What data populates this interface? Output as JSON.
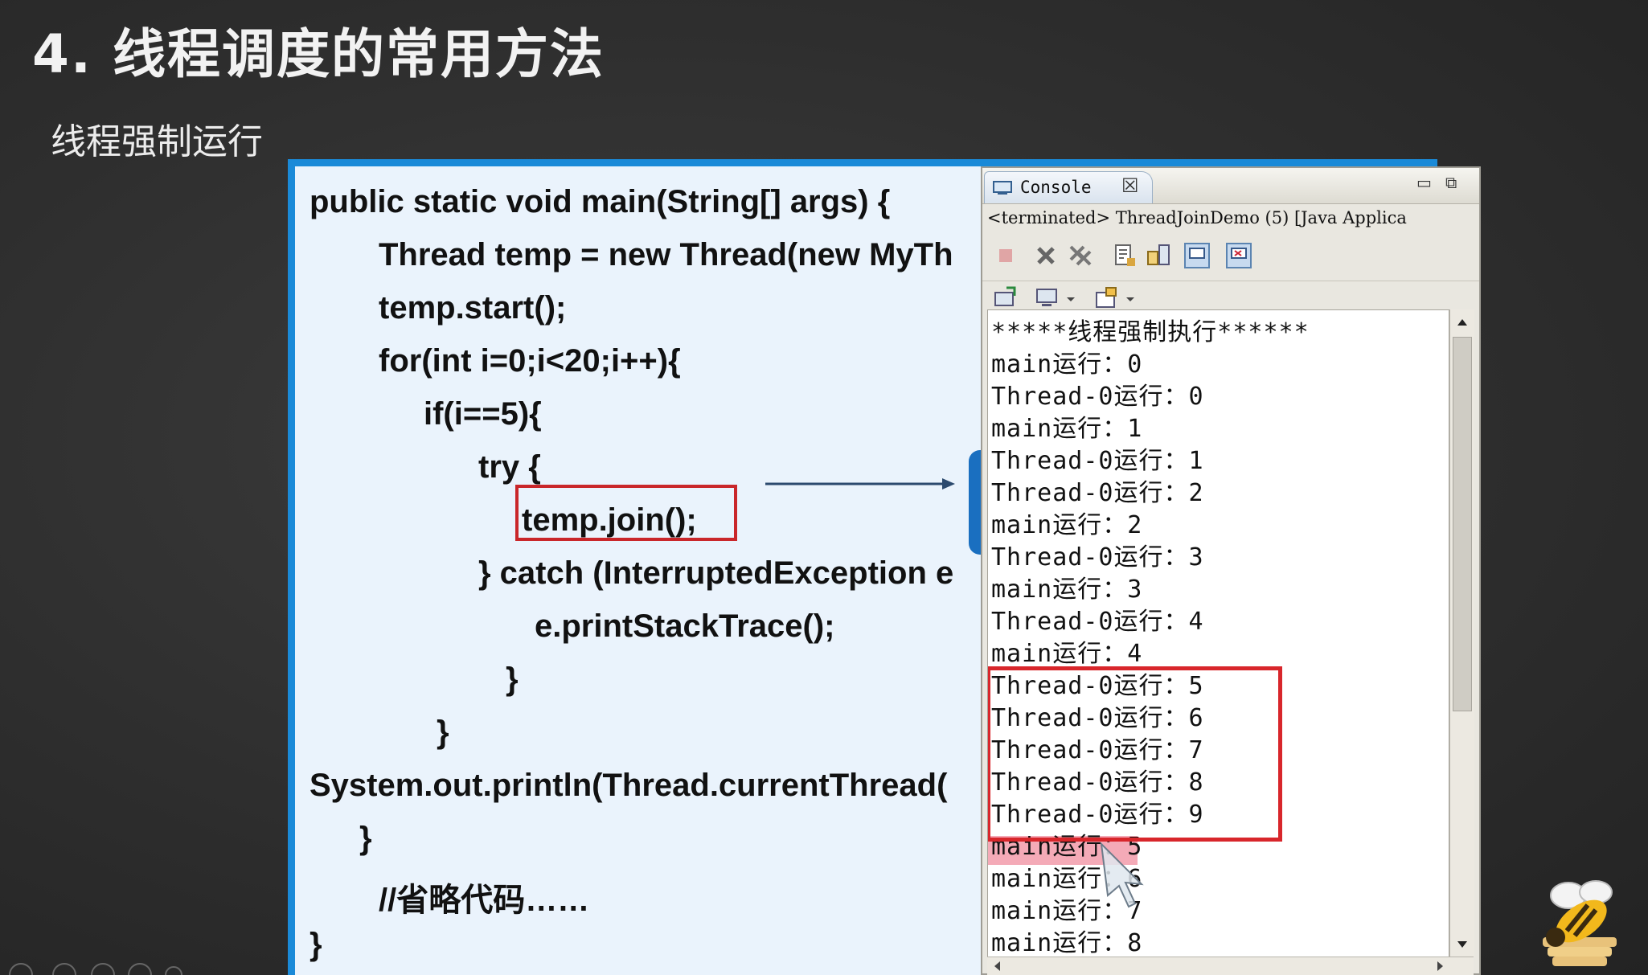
{
  "slide": {
    "title": "4. 线程调度的常用方法",
    "subtitle": "线程强制运行"
  },
  "code": {
    "lines": [
      "public static void main(String[] args) {",
      "Thread temp = new Thread(new MyTh",
      "temp.start();",
      "for(int i=0;i<20;i++){",
      "if(i==5){",
      "try {",
      "temp.join();",
      "} catch (InterruptedException e",
      "e.printStackTrace();",
      "}",
      "}",
      "System.out.println(Thread.currentThread(",
      "}",
      "//省略代码……",
      "}"
    ]
  },
  "console": {
    "tab_label": "Console",
    "tab_close": "☒",
    "minimize": "▭",
    "restore": "⧉",
    "status": "<terminated> ThreadJoinDemo (5) [Java Applica",
    "output": [
      "*****线程强制执行******",
      "main运行：0",
      "Thread-0运行：0",
      "main运行：1",
      "Thread-0运行：1",
      "Thread-0运行：2",
      "main运行：2",
      "Thread-0运行：3",
      "main运行：3",
      "Thread-0运行：4",
      "main运行：4",
      "Thread-0运行：5",
      "Thread-0运行：6",
      "Thread-0运行：7",
      "Thread-0运行：8",
      "Thread-0运行：9",
      "main运行：5",
      "main运行：6",
      "main运行：7",
      "main运行：8"
    ]
  },
  "icons": [
    "console-icon",
    "terminate-icon",
    "remove-launch-icon",
    "remove-all-icon",
    "scroll-lock-icon",
    "show-console-icon",
    "pin-icon",
    "open-console-icon",
    "display-console-icon",
    "new-console-icon",
    "mouse-cursor-icon",
    "bee-logo-icon"
  ],
  "colors": {
    "panel_border": "#1a8ad8",
    "highlight_box": "#d8262b",
    "selection": "#f4aab7"
  }
}
